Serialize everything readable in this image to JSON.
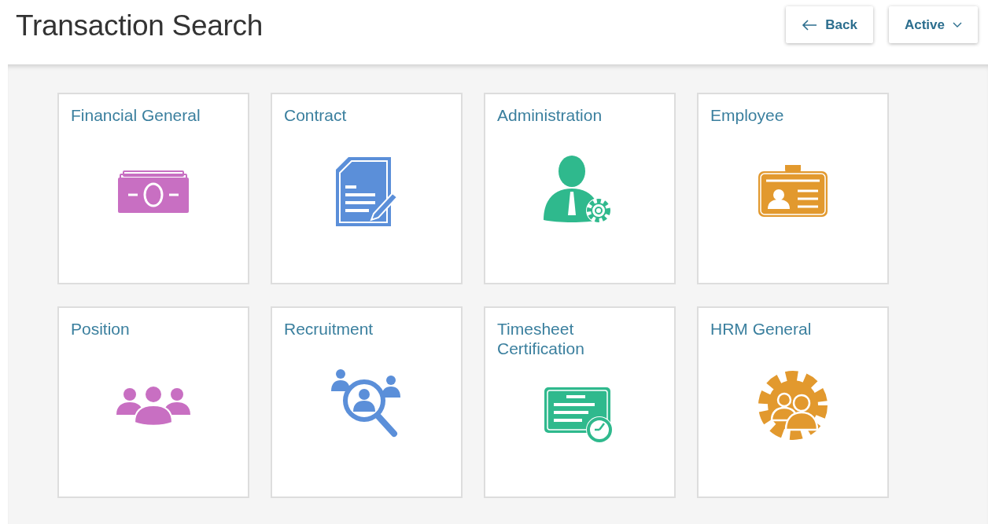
{
  "header": {
    "title": "Transaction Search",
    "back_button": "Back",
    "status_dropdown": "Active"
  },
  "tiles": [
    {
      "label": "Financial General",
      "kind": "money",
      "color": "#c86fc2"
    },
    {
      "label": "Contract",
      "kind": "document",
      "color": "#5b8fd9"
    },
    {
      "label": "Administration",
      "kind": "admin",
      "color": "#2fb98d"
    },
    {
      "label": "Employee",
      "kind": "badge",
      "color": "#e2992e"
    },
    {
      "label": "Position",
      "kind": "group",
      "color": "#c86fc2"
    },
    {
      "label": "Recruitment",
      "kind": "recruit",
      "color": "#5b8fd9"
    },
    {
      "label": "Timesheet Certification",
      "kind": "timesheet",
      "color": "#2fb98d"
    },
    {
      "label": "HRM General",
      "kind": "gearpeople",
      "color": "#e2992e"
    }
  ]
}
